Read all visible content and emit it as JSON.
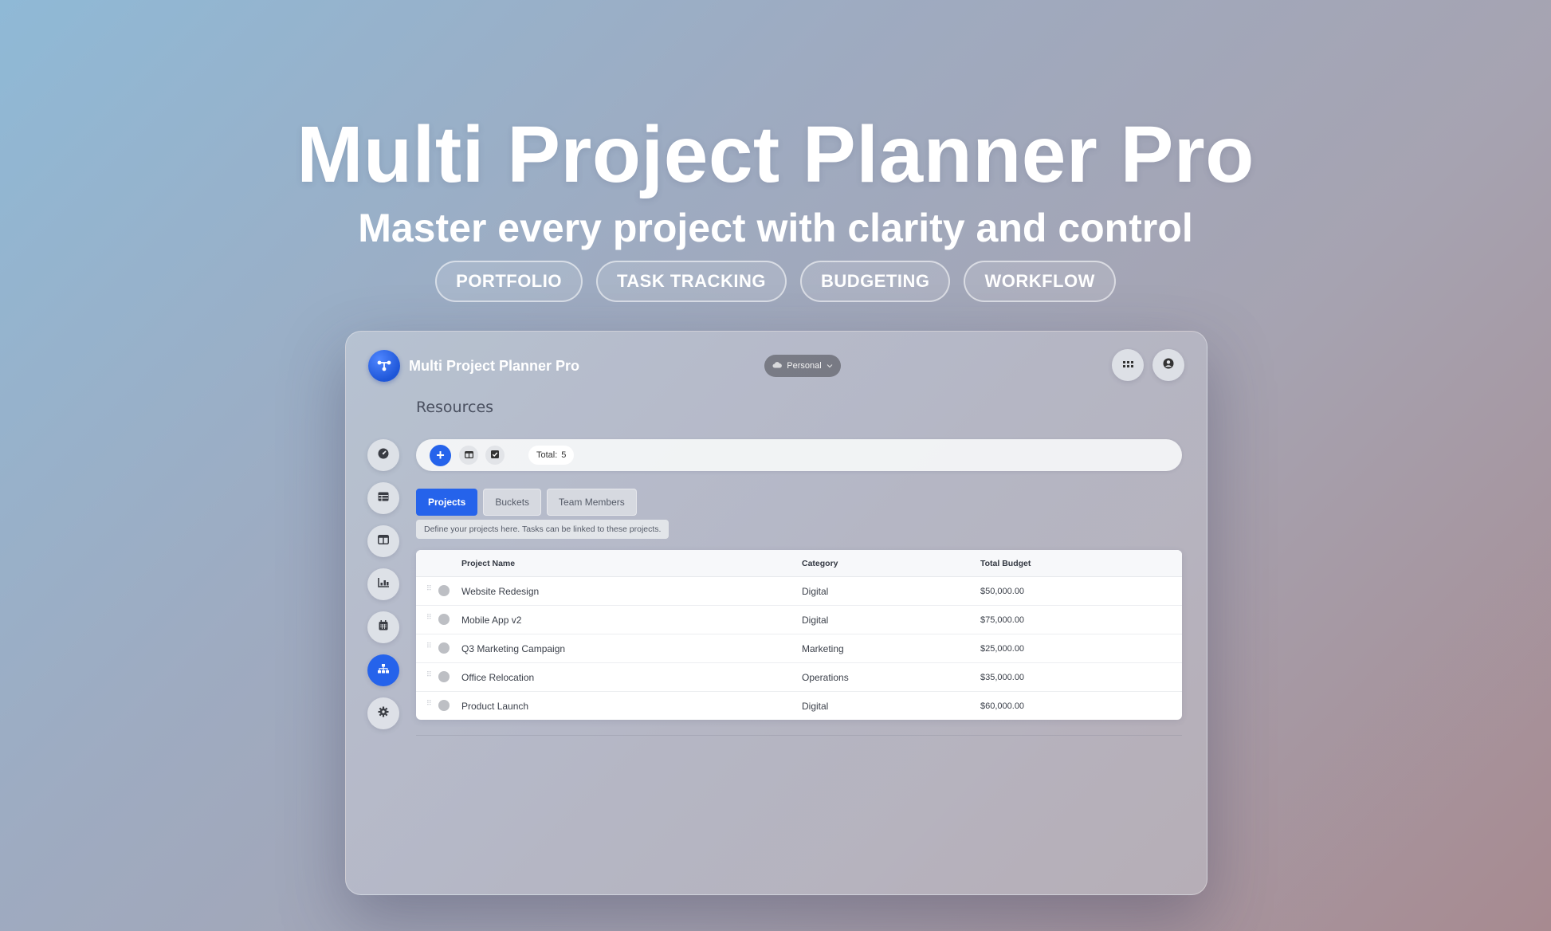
{
  "hero": {
    "title": "Multi Project Planner Pro",
    "subtitle": "Master every project with clarity and control",
    "tags": [
      "PORTFOLIO",
      "TASK TRACKING",
      "BUDGETING",
      "WORKFLOW"
    ]
  },
  "app": {
    "title": "Multi Project Planner Pro",
    "workspace": "Personal",
    "page_title": "Resources"
  },
  "sidebar": {
    "items": [
      {
        "icon": "dashboard-icon",
        "active": false
      },
      {
        "icon": "table-icon",
        "active": false
      },
      {
        "icon": "board-icon",
        "active": false
      },
      {
        "icon": "chart-icon",
        "active": false
      },
      {
        "icon": "calendar-icon",
        "active": false
      },
      {
        "icon": "hierarchy-icon",
        "active": true
      },
      {
        "icon": "gear-icon",
        "active": false
      }
    ]
  },
  "toolbar": {
    "total_label": "Total:",
    "total_value": "5"
  },
  "tabs": [
    {
      "label": "Projects",
      "active": true
    },
    {
      "label": "Buckets",
      "active": false
    },
    {
      "label": "Team Members",
      "active": false
    }
  ],
  "hint": "Define your projects here. Tasks can be linked to these projects.",
  "table": {
    "columns": [
      "Project Name",
      "Category",
      "Total Budget"
    ],
    "rows": [
      {
        "name": "Website Redesign",
        "category": "Digital",
        "budget": "$50,000.00"
      },
      {
        "name": "Mobile App v2",
        "category": "Digital",
        "budget": "$75,000.00"
      },
      {
        "name": "Q3 Marketing Campaign",
        "category": "Marketing",
        "budget": "$25,000.00"
      },
      {
        "name": "Office Relocation",
        "category": "Operations",
        "budget": "$35,000.00"
      },
      {
        "name": "Product Launch",
        "category": "Digital",
        "budget": "$60,000.00"
      }
    ]
  },
  "colors": {
    "accent": "#2563eb",
    "status_dot": "#bdbfc4"
  }
}
